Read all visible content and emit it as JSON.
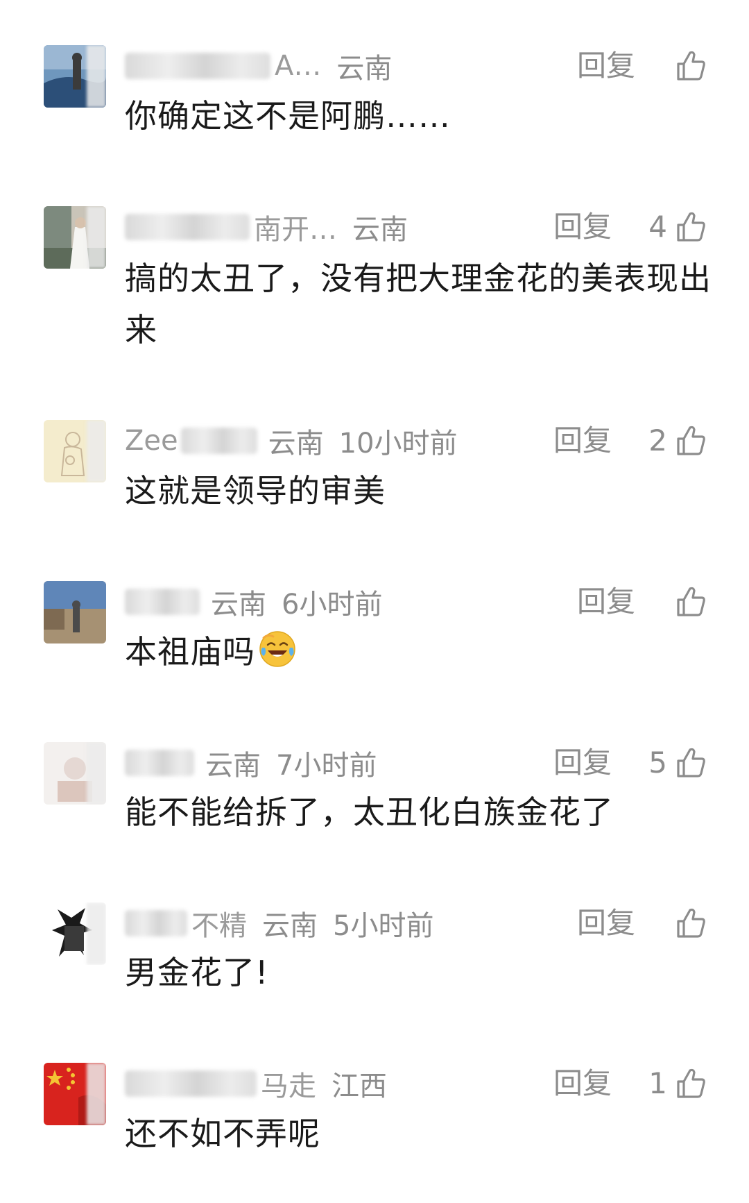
{
  "comments": [
    {
      "name": "A…",
      "region": "云南",
      "time": "",
      "reply": "回复",
      "likes": "",
      "text": "你确定这不是阿鹏……",
      "avatar_colors": [
        "#2c4f78",
        "#6f97bd",
        "#3b3b3b"
      ]
    },
    {
      "name": "南开…",
      "region": "云南",
      "time": "",
      "reply": "回复",
      "likes": "4",
      "text": "搞的太丑了，没有把大理金花的美表现出来",
      "avatar_colors": [
        "#7d8a7e",
        "#c9c4b8",
        "#5d6b5a"
      ]
    },
    {
      "name": "Zee",
      "region": "云南",
      "time": "10小时前",
      "reply": "回复",
      "likes": "2",
      "text": "这就是领导的审美",
      "avatar_colors": [
        "#f4eccd",
        "#efe1b5",
        "#c9b79a"
      ]
    },
    {
      "name": "",
      "region": "云南",
      "time": "6小时前",
      "reply": "回复",
      "likes": "",
      "text": "本祖庙吗",
      "emoji": "laughing-crying",
      "avatar_colors": [
        "#5f86b8",
        "#a69173",
        "#4b4b4b"
      ]
    },
    {
      "name": "",
      "region": "云南",
      "time": "7小时前",
      "reply": "回复",
      "likes": "5",
      "text": "能不能给拆了，太丑化白族金花了",
      "avatar_colors": [
        "#f3f0ee",
        "#e5d8d3",
        "#dcc6bd"
      ]
    },
    {
      "name": "不精",
      "region": "云南",
      "time": "5小时前",
      "reply": "回复",
      "likes": "",
      "text": "男金花了!",
      "avatar_colors": [
        "#ffffff",
        "#1a1a1a",
        "#3a3a3a"
      ]
    },
    {
      "name": "马走",
      "region": "江西",
      "time": "",
      "reply": "回复",
      "likes": "1",
      "text": "还不如不弄呢",
      "avatar_colors": [
        "#d8231e",
        "#f4c534",
        "#b11a16"
      ]
    }
  ]
}
